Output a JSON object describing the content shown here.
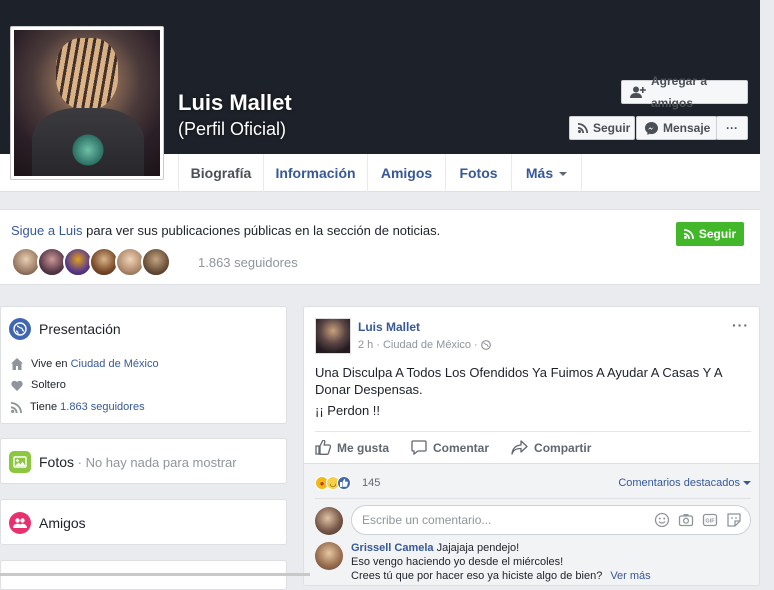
{
  "profile": {
    "name": "Luis Mallet",
    "subtitle": "(Perfil Oficial)",
    "buttons": {
      "add_friend": "Agregar a amigos",
      "follow": "Seguir",
      "message": "Mensaje",
      "more": "···"
    }
  },
  "tabs": [
    {
      "label": "Biografía",
      "active": true
    },
    {
      "label": "Información"
    },
    {
      "label": "Amigos"
    },
    {
      "label": "Fotos"
    },
    {
      "label": "Más"
    }
  ],
  "follow_bar": {
    "link": "Sigue a Luis",
    "text": " para ver sus publicaciones públicas en la sección de noticias.",
    "button": "Seguir",
    "followers": "1.863 seguidores"
  },
  "intro": {
    "title": "Presentación",
    "lives_prefix": "Vive en ",
    "lives_city": "Ciudad de México",
    "relationship": "Soltero",
    "has_prefix": "Tiene ",
    "followers_link": "1.863 seguidores"
  },
  "photos_card": {
    "title": "Fotos",
    "empty": " · No hay nada para mostrar"
  },
  "friends_card": {
    "title": "Amigos"
  },
  "post": {
    "author": "Luis Mallet",
    "time": "2 h",
    "location": "Ciudad de México",
    "text": "Una Disculpa A Todos Los Ofendidos Ya Fuimos A Ayudar A Casas Y A Donar Despensas.",
    "text2": "¡¡ Perdon !!",
    "actions": {
      "like": "Me gusta",
      "comment": "Comentar",
      "share": "Compartir"
    },
    "reaction_count": "145",
    "featured_comments": "Comentarios destacados",
    "comment_placeholder": "Escribe un comentario...",
    "comment": {
      "name": "Grissell Camela",
      "line1": " Jajajaja pendejo!",
      "line2": "Eso vengo haciendo yo desde el miércoles!",
      "line3": "Crees tú que por hacer eso ya hiciste algo de bien?",
      "see_more": "Ver más"
    }
  },
  "colors": {
    "header": "#1d2129",
    "link": "#365899",
    "green": "#42b72a",
    "background": "#e9ebee"
  }
}
